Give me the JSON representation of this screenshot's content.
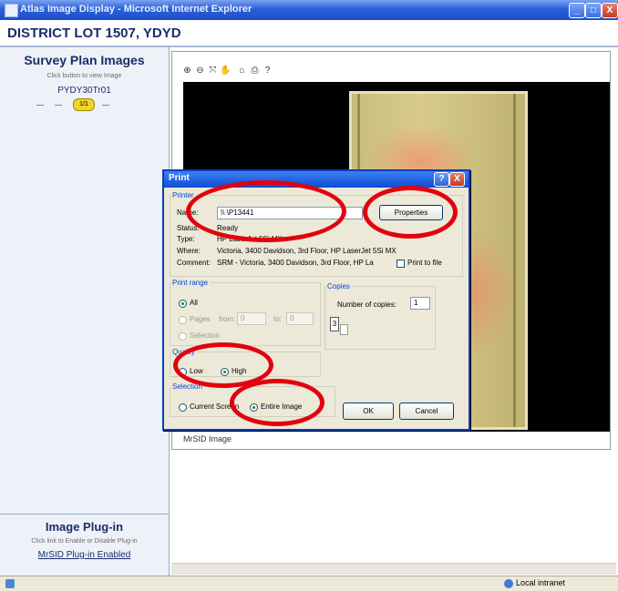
{
  "window": {
    "title": "Atlas Image Display - Microsoft Internet Explorer",
    "buttons": {
      "minimize": "_",
      "maximize": "□",
      "close": "X"
    }
  },
  "header": {
    "district": "DISTRICT LOT 1507, YDYD"
  },
  "left_panel": {
    "survey_title": "Survey Plan Images",
    "survey_instruction": "Click button to view Image",
    "plan_name": "PYDY30Tr01",
    "plan_button": "1/1",
    "plugin_title": "Image Plug-in",
    "plugin_instruction": "Click link to Enable or Disable Plug-in",
    "plugin_link": "MrSID Plug-in Enabled"
  },
  "viewer": {
    "tools": [
      "zoom-in-icon",
      "zoom-out-icon",
      "zoom-fit-icon",
      "pan-icon",
      "home-icon",
      "print-icon",
      "help-icon"
    ],
    "tool_glyphs": [
      "⊕",
      "⊖",
      "⤧",
      "✋",
      "⌂",
      "⎙",
      "?"
    ],
    "caption": "MrSID Image"
  },
  "statusbar": {
    "zone": "Local intranet"
  },
  "print_dialog": {
    "title": "Print",
    "help_button": "?",
    "close_button": "X",
    "printer": {
      "legend": "Printer",
      "name_label": "Name:",
      "name_value": "\\\\            \\P13441",
      "properties_button": "Properties",
      "status_label": "Status:",
      "status_value": "Ready",
      "type_label": "Type:",
      "type_value": "HP LaserJet 5Si MX",
      "where_label": "Where:",
      "where_value": "Victoria, 3400 Davidson, 3rd Floor, HP LaserJet 5Si MX",
      "comment_label": "Comment:",
      "comment_value": "SRM - Victoria, 3400 Davidson, 3rd Floor, HP La",
      "print_to_file": "Print to file"
    },
    "print_range": {
      "legend": "Print range",
      "all": "All",
      "pages": "Pages",
      "from_label": "from:",
      "from_value": "0",
      "to_label": "to:",
      "to_value": "0",
      "selection": "Selection"
    },
    "copies": {
      "legend": "Copies",
      "label": "Number of copies:",
      "value": "1",
      "collate_glyph": "3"
    },
    "quality": {
      "legend": "Quality",
      "low": "Low",
      "high": "High",
      "selected": "High"
    },
    "selection": {
      "legend": "Selection",
      "current_screen": "Current Screen",
      "entire_image": "Entire Image",
      "selected": "Entire Image"
    },
    "ok_button": "OK",
    "cancel_button": "Cancel"
  },
  "annotation_color": "#e3000f"
}
